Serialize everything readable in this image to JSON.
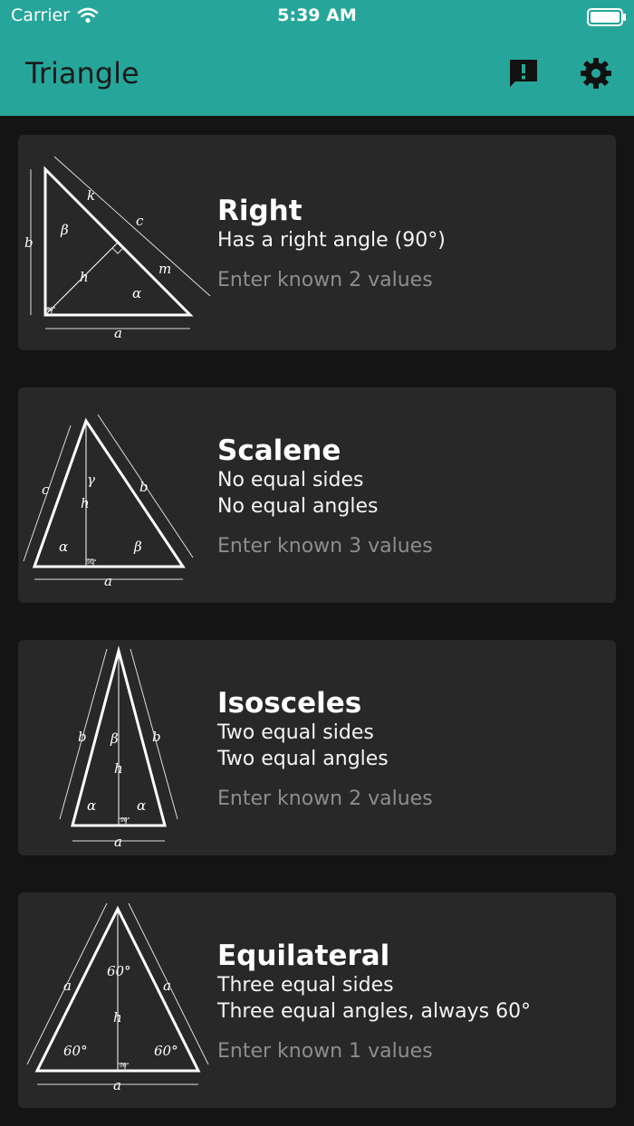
{
  "status_bar": {
    "carrier": "Carrier",
    "time": "5:39 AM"
  },
  "app_bar": {
    "title": "Triangle",
    "icons": [
      "feedback-icon",
      "gear-icon"
    ]
  },
  "colors": {
    "app_bar": "#26a69a",
    "card": "#282828",
    "background": "#141414",
    "hint": "#8d8d8d"
  },
  "cards": [
    {
      "title": "Right",
      "lines": [
        "Has a right angle (90°)"
      ],
      "hint": "Enter known 2 values",
      "figure_labels": {
        "a": "a",
        "b": "b",
        "c": "c",
        "k": "k",
        "m": "m",
        "h": "h",
        "alpha": "α",
        "beta": "β",
        "right": "90°"
      }
    },
    {
      "title": "Scalene",
      "lines": [
        "No equal sides",
        "No equal angles"
      ],
      "hint": "Enter known 3 values",
      "figure_labels": {
        "a": "a",
        "b": "b",
        "c": "c",
        "h": "h",
        "alpha": "α",
        "beta": "β",
        "gamma": "γ",
        "right": "90°"
      }
    },
    {
      "title": "Isosceles",
      "lines": [
        "Two equal sides",
        "Two equal angles"
      ],
      "hint": "Enter known 2 values",
      "figure_labels": {
        "a": "a",
        "b": "b",
        "h": "h",
        "alpha": "α",
        "beta": "β",
        "right": "90°"
      }
    },
    {
      "title": "Equilateral",
      "lines": [
        "Three equal sides",
        "Three equal angles, always 60°"
      ],
      "hint": "Enter known 1 values",
      "figure_labels": {
        "a": "a",
        "h": "h",
        "angle": "60°",
        "right": "90°"
      }
    }
  ]
}
